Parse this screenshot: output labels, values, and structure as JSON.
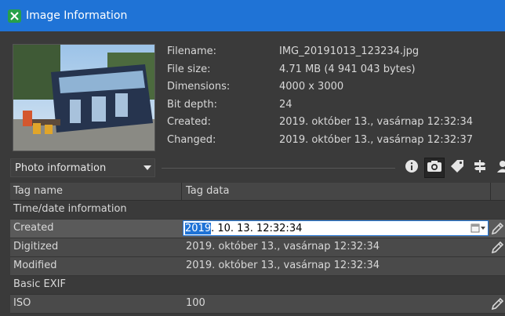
{
  "window": {
    "title": "Image Information"
  },
  "file_info": [
    {
      "label": "Filename:",
      "value": "IMG_20191013_123234.jpg"
    },
    {
      "label": "File size:",
      "value": "4.71 MB (4 941 043 bytes)"
    },
    {
      "label": "Dimensions:",
      "value": "4000 x 3000"
    },
    {
      "label": "Bit depth:",
      "value": "24"
    },
    {
      "label": "Created:",
      "value": "2019. október 13., vasárnap 12:32:34"
    },
    {
      "label": "Changed:",
      "value": "2019. október 13., vasárnap 12:32:37"
    }
  ],
  "category_dropdown": {
    "selected": "Photo information"
  },
  "tabs": [
    {
      "icon": "info-icon",
      "active": false
    },
    {
      "icon": "camera-icon",
      "active": true
    },
    {
      "icon": "tag-icon",
      "active": false
    },
    {
      "icon": "signpost-icon",
      "active": false
    },
    {
      "icon": "person-icon",
      "active": false
    }
  ],
  "table": {
    "headers": [
      "Tag name",
      "Tag data"
    ],
    "rows": [
      {
        "type": "group",
        "name": "Time/date information",
        "data": ""
      },
      {
        "type": "data",
        "name": "Created",
        "data_selected": "2019",
        "data_rest": ". 10. 13. 12:32:34",
        "editing": true
      },
      {
        "type": "data",
        "name": "Digitized",
        "data": "2019. október 13., vasárnap 12:32:34"
      },
      {
        "type": "data",
        "name": "Modified",
        "data": "2019. október 13., vasárnap 12:32:34"
      },
      {
        "type": "group",
        "name": "Basic EXIF",
        "data": ""
      },
      {
        "type": "data",
        "name": "ISO",
        "data": "100"
      }
    ]
  },
  "colors": {
    "titlebar": "#1f73d6",
    "background": "#3a3a3a",
    "row": "#4a4a4a"
  }
}
